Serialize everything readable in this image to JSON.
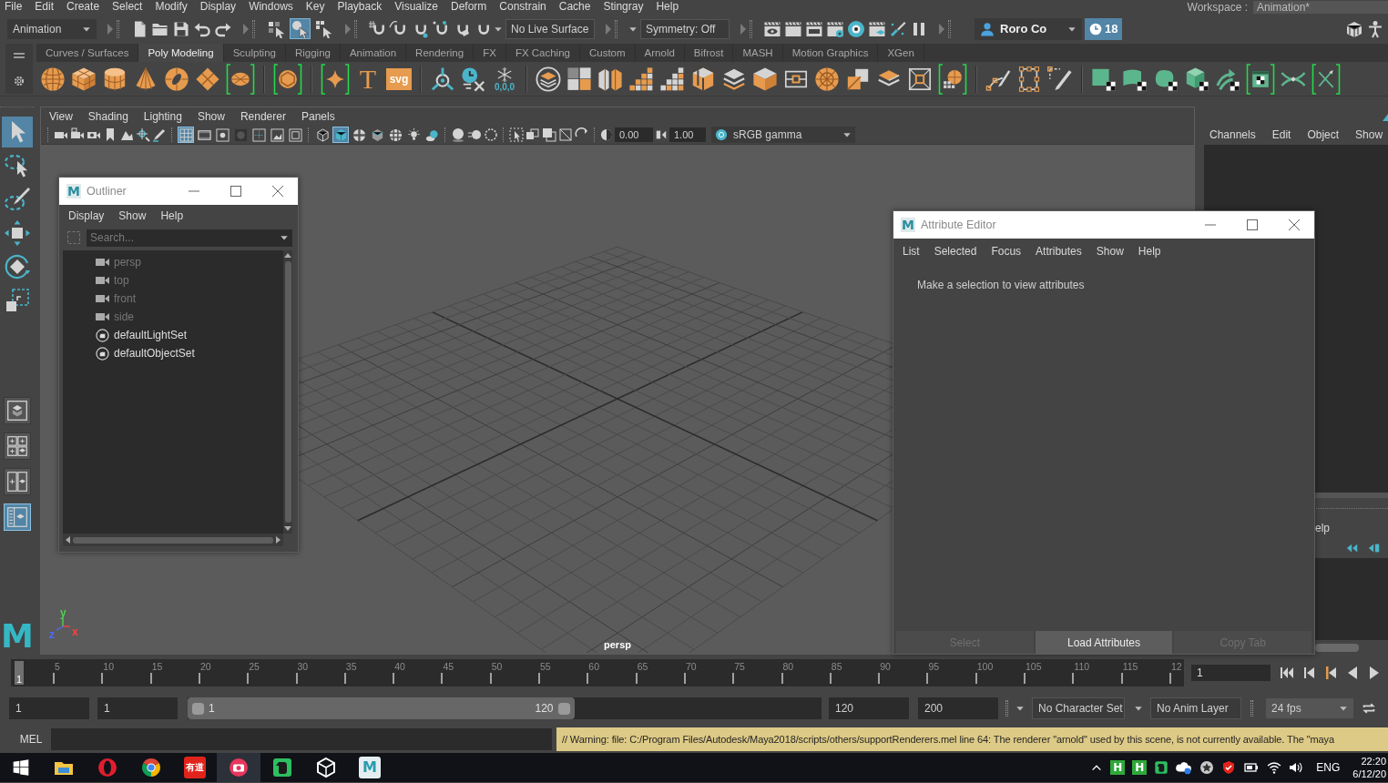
{
  "menu_bar": {
    "items": [
      "File",
      "Edit",
      "Create",
      "Select",
      "Modify",
      "Display",
      "Windows",
      "Key",
      "Playback",
      "Visualize",
      "Deform",
      "Constrain",
      "Cache",
      "Stingray",
      "Help"
    ],
    "workspace_label": "Workspace :",
    "workspace": "Animation*"
  },
  "status_line": {
    "menu_set": "Animation",
    "selection_modes": [
      {
        "selected": false
      },
      {
        "selected": true
      },
      {
        "selected": false
      }
    ],
    "live_surface": "No Live Surface",
    "symmetry": "Symmetry: Off",
    "user": "Roro Co",
    "notifications": "18"
  },
  "shelf": {
    "tabs": [
      {
        "label": "Curves / Surfaces",
        "selected": false
      },
      {
        "label": "Poly Modeling",
        "selected": true
      },
      {
        "label": "Sculpting",
        "selected": false
      },
      {
        "label": "Rigging",
        "selected": false
      },
      {
        "label": "Animation",
        "selected": false
      },
      {
        "label": "Rendering",
        "selected": false
      },
      {
        "label": "FX",
        "selected": false
      },
      {
        "label": "FX Caching",
        "selected": false
      },
      {
        "label": "Custom",
        "selected": false
      },
      {
        "label": "Arnold",
        "selected": false
      },
      {
        "label": "Bifrost",
        "selected": false
      },
      {
        "label": "MASH",
        "selected": false
      },
      {
        "label": "Motion Graphics",
        "selected": false
      },
      {
        "label": "XGen",
        "selected": false
      }
    ],
    "type_tool": "T",
    "svg_tool": "svg",
    "freeze_label": "0,0,0"
  },
  "toolbox": {
    "tools": [
      {
        "selected": true
      },
      {
        "selected": false
      },
      {
        "selected": false
      },
      {
        "selected": false
      },
      {
        "selected": false
      },
      {
        "selected": false
      }
    ],
    "layouts": [
      {
        "selected": false
      },
      {
        "selected": false
      },
      {
        "selected": false
      },
      {
        "selected": true
      }
    ],
    "logo": "M"
  },
  "viewport": {
    "menu": [
      "View",
      "Shading",
      "Lighting",
      "Show",
      "Renderer",
      "Panels"
    ],
    "display_toggles": [
      {
        "on": true
      },
      {
        "on": false
      },
      {
        "on": false
      },
      {
        "on": false
      },
      {
        "on": false
      },
      {
        "on": false
      },
      {
        "on": false
      }
    ],
    "shading_toggles": [
      {
        "on": false
      },
      {
        "on": true
      },
      {
        "on": false
      },
      {
        "on": false
      },
      {
        "on": false
      },
      {
        "on": false
      },
      {
        "on": false
      }
    ],
    "exposure": "0.00",
    "gamma": "1.00",
    "color_space": "sRGB gamma",
    "axes": [
      {
        "label": "y",
        "color": "#4fd04f"
      },
      {
        "label": "z",
        "color": "#4d6bff"
      },
      {
        "label": "x",
        "color": "#ff4040"
      }
    ],
    "camera": "persp"
  },
  "outliner": {
    "logo": "M",
    "title": "Outliner",
    "menu": [
      "Display",
      "Show",
      "Help"
    ],
    "search": {
      "placeholder": "Search..."
    },
    "items": [
      {
        "label": "persp",
        "kind": "camera",
        "disabled": true
      },
      {
        "label": "top",
        "kind": "camera",
        "disabled": true
      },
      {
        "label": "front",
        "kind": "camera",
        "disabled": true
      },
      {
        "label": "side",
        "kind": "camera",
        "disabled": true
      },
      {
        "label": "defaultLightSet",
        "kind": "set",
        "disabled": false
      },
      {
        "label": "defaultObjectSet",
        "kind": "set",
        "disabled": false
      }
    ]
  },
  "attribute_editor": {
    "logo": "M",
    "title": "Attribute Editor",
    "menu": [
      "List",
      "Selected",
      "Focus",
      "Attributes",
      "Show",
      "Help"
    ],
    "message": "Make a selection to view attributes",
    "buttons": [
      {
        "label": "Select",
        "disabled": true
      },
      {
        "label": "Load Attributes",
        "disabled": false
      },
      {
        "label": "Copy Tab",
        "disabled": true
      }
    ]
  },
  "channel_box": {
    "menu": [
      "Channels",
      "Edit",
      "Object",
      "Show"
    ],
    "layer_menu_fragment": "elp"
  },
  "time_slider": {
    "ticks": [
      "5",
      "10",
      "15",
      "20",
      "25",
      "30",
      "35",
      "40",
      "45",
      "50",
      "55",
      "60",
      "65",
      "70",
      "75",
      "80",
      "85",
      "90",
      "95",
      "100",
      "105",
      "110",
      "115",
      "12"
    ],
    "playhead": {
      "level": 0
    },
    "current_frame_marker": "1",
    "current_frame": "1"
  },
  "range_slider": {
    "start": "1",
    "playback_start": "1",
    "range_start": "1",
    "range_end": "120",
    "range_bar": {
      "level": 0.61
    },
    "playback_end": "120",
    "end": "200",
    "character_set": "No Character Set",
    "anim_layer": "No Anim Layer",
    "fps": "24 fps"
  },
  "command_line": {
    "language": "MEL",
    "message": "// Warning: file: C:/Program Files/Autodesk/Maya2018/scripts/others/supportRenderers.mel line 64: The renderer \"arnold\" used by this scene, is not currently available. The \"maya"
  },
  "taskbar": {
    "apps": [
      {
        "kind": "explorer",
        "active": false
      },
      {
        "kind": "opera",
        "active": false
      },
      {
        "kind": "chrome",
        "active": false
      },
      {
        "kind": "youdao",
        "label": "有道",
        "active": false
      },
      {
        "kind": "camera",
        "active": true
      },
      {
        "kind": "evernote",
        "active": false
      },
      {
        "kind": "unity",
        "active": false
      },
      {
        "kind": "maya",
        "label": "M",
        "active": false
      }
    ],
    "tray_letters": [
      "H",
      "H"
    ],
    "language": "ENG",
    "time": "22:20",
    "date": "6/12/20"
  }
}
